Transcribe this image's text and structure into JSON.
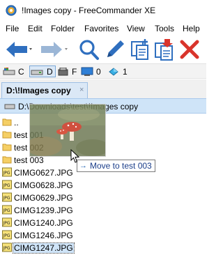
{
  "window": {
    "title": "!Images copy - FreeCommander XE",
    "icon": "freecommander-app-icon"
  },
  "menu": [
    "File",
    "Edit",
    "Folder",
    "Favorites",
    "View",
    "Tools",
    "Help"
  ],
  "toolbar": {
    "icons": [
      "back-arrow-icon",
      "forward-arrow-icon",
      "search-icon",
      "edit-pencil-icon",
      "copy-icon",
      "move-icon",
      "delete-icon"
    ]
  },
  "drives": [
    {
      "label": "C",
      "icon": "drive-c-icon",
      "selected": false
    },
    {
      "label": "D",
      "icon": "drive-d-icon",
      "selected": true
    },
    {
      "label": "F",
      "icon": "drive-f-icon",
      "selected": false
    },
    {
      "label": "0",
      "icon": "desktop-icon",
      "selected": false
    },
    {
      "label": "1",
      "icon": "network-icon",
      "selected": false
    }
  ],
  "tab": {
    "label": "D:\\!Images copy",
    "close": "×"
  },
  "path": {
    "text": "D:\\Downloads\\test\\!Images copy"
  },
  "files": [
    {
      "name": "..",
      "type": "folder"
    },
    {
      "name": "test 001",
      "type": "folder"
    },
    {
      "name": "test 002",
      "type": "folder"
    },
    {
      "name": "test 003",
      "type": "folder"
    },
    {
      "name": "CIMG0627.JPG",
      "type": "jpg"
    },
    {
      "name": "CIMG0628.JPG",
      "type": "jpg"
    },
    {
      "name": "CIMG0629.JPG",
      "type": "jpg"
    },
    {
      "name": "CIMG1239.JPG",
      "type": "jpg"
    },
    {
      "name": "CIMG1240.JPG",
      "type": "jpg"
    },
    {
      "name": "CIMG1246.JPG",
      "type": "jpg"
    },
    {
      "name": "CIMG1247.JPG",
      "type": "jpg",
      "selected": true
    }
  ],
  "drag": {
    "tooltip": "Move to test 003",
    "tooltip_icon": "move-arrow-icon"
  },
  "colors": {
    "accent": "#1b5fb0",
    "selection": "#cfe4f8",
    "tab_bg": "#dbe8f6",
    "delete_red": "#d9342b",
    "folder_yellow": "#f5cf65"
  }
}
